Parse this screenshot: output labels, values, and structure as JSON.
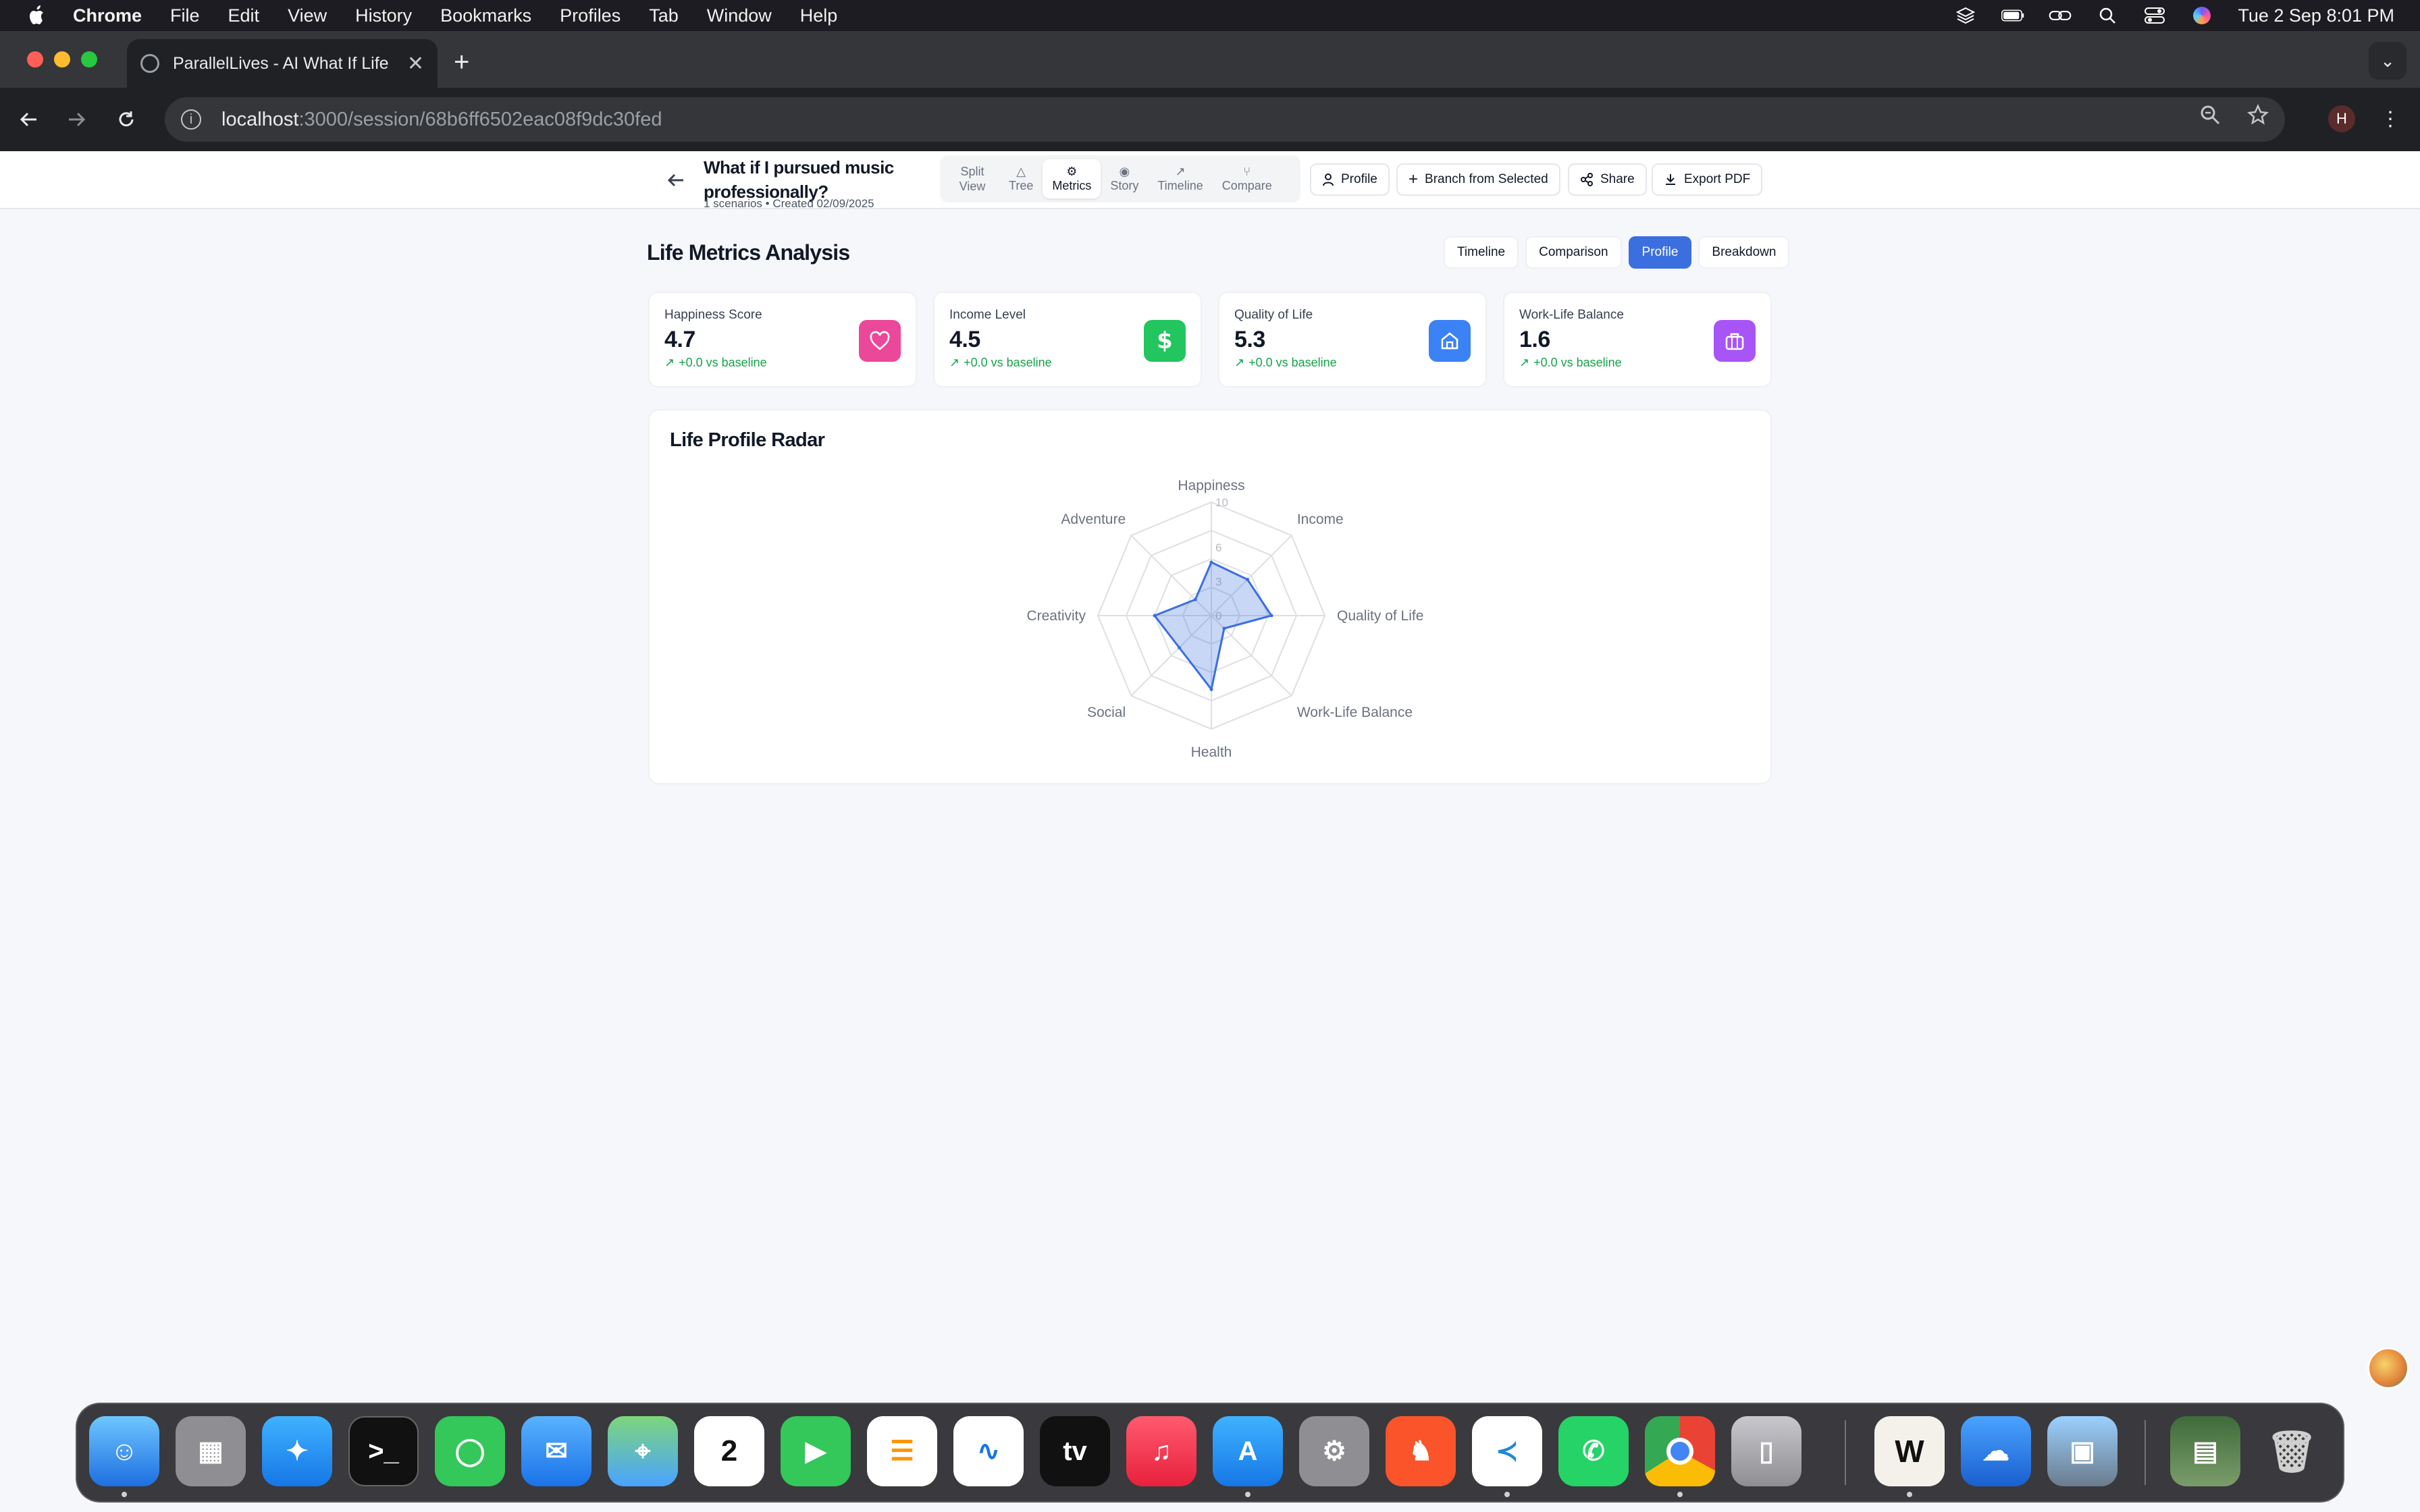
{
  "menubar": {
    "items": [
      "Chrome",
      "File",
      "Edit",
      "View",
      "History",
      "Bookmarks",
      "Profiles",
      "Tab",
      "Window",
      "Help"
    ],
    "clock": "Tue 2 Sep  8:01 PM"
  },
  "browser": {
    "tab_title": "ParallelLives - AI What If Life",
    "url_host": "localhost",
    "url_path": ":3000/session/68b6ff6502eac08f9dc30fed",
    "profile_initial": "H"
  },
  "header": {
    "title": "What if I pursued music professionally?",
    "subtitle": "1 scenarios • Created 02/09/2025",
    "view_tabs": [
      {
        "label": "Split View",
        "icon": "split-icon"
      },
      {
        "label": "Tree",
        "icon": "tree-icon"
      },
      {
        "label": "Metrics",
        "icon": "gear-icon",
        "active": true
      },
      {
        "label": "Story",
        "icon": "eye-icon"
      },
      {
        "label": "Timeline",
        "icon": "trend-icon"
      },
      {
        "label": "Compare",
        "icon": "branch-icon"
      }
    ],
    "buttons": {
      "profile": "Profile",
      "branch": "Branch from Selected",
      "share": "Share",
      "export": "Export PDF"
    }
  },
  "main": {
    "heading": "Life Metrics Analysis",
    "mode_tabs": [
      "Timeline",
      "Comparison",
      "Profile",
      "Breakdown"
    ],
    "active_mode": "Profile",
    "metrics": [
      {
        "label": "Happiness Score",
        "value": "4.7",
        "delta": "+0.0 vs baseline",
        "icon": "heart-icon",
        "color": "#ec4899"
      },
      {
        "label": "Income Level",
        "value": "4.5",
        "delta": "+0.0 vs baseline",
        "icon": "dollar-icon",
        "color": "#22c55e"
      },
      {
        "label": "Quality of Life",
        "value": "5.3",
        "delta": "+0.0 vs baseline",
        "icon": "home-icon",
        "color": "#3b82f6"
      },
      {
        "label": "Work-Life Balance",
        "value": "1.6",
        "delta": "+0.0 vs baseline",
        "icon": "briefcase-icon",
        "color": "#a855f7"
      }
    ],
    "radar": {
      "title": "Life Profile Radar",
      "ticks": [
        "0",
        "3",
        "6",
        "10"
      ]
    }
  },
  "chart_data": {
    "type": "radar",
    "title": "Life Profile Radar",
    "categories": [
      "Happiness",
      "Income",
      "Quality of Life",
      "Work-Life Balance",
      "Health",
      "Social",
      "Creativity",
      "Adventure"
    ],
    "values": [
      4.7,
      4.5,
      5.3,
      1.6,
      6.5,
      4.0,
      5.0,
      2.0
    ],
    "range": [
      0,
      10
    ],
    "ticks": [
      0,
      3,
      6,
      10
    ],
    "color": "#3b6fe0"
  }
}
